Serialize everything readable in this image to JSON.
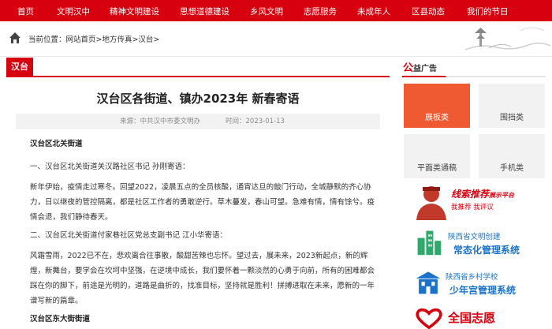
{
  "nav": {
    "items": [
      "首页",
      "文明汉中",
      "精神文明建设",
      "思想道德建设",
      "乡风文明",
      "志愿服务",
      "未成年人",
      "区县动态",
      "我们的节日"
    ]
  },
  "breadcrumb": {
    "label": "当前位置：",
    "path": "网站首页>地方传真>汉台>"
  },
  "section": {
    "tab": "汉台"
  },
  "article": {
    "title": "汉台区各街道、镇办2023年  新春寄语",
    "source": "来源：中共汉中市委文明办",
    "time": "时间：2023-01-13",
    "paragraphs": [
      {
        "bold": true,
        "text": "汉台区北关街道"
      },
      {
        "bold": false,
        "text": "一、汉台区北关街道关汉路社区书记 孙刚寄语："
      },
      {
        "bold": false,
        "text": "新年伊始，疫情走过寒冬。回望2022，凌晨五点的全员核酸，通宵达旦的敲门行动，全城静默的齐心协力，日以继夜的管控隔离，都是社区工作者的勇敢逆行。草木蔓发，春山可望。急难有情，情有馀兮。疫情会退，我们静待春天。"
      },
      {
        "bold": false,
        "text": "二、汉台区北关街道付家巷社区党总支副书记 江小华寄语："
      },
      {
        "bold": false,
        "text": "风霜雪雨，2022已不在，悲欢离合往事散，酸甜苦辣也忘怀。望过去，展未来，2023新起点，新的辉煌，新舞台，要学会在坎坷中坚强，在逆境中成长，我们要怀着一颗淡然的心勇于向前，所有的困难都会踩在你的脚下，前途是光明的，道路是曲折的，找准目标，坚持就是胜利！拼搏进取在未来，愿新的一年谱写新的篇章。"
      },
      {
        "bold": true,
        "text": "汉台区东大街街道"
      }
    ]
  },
  "ads": {
    "title_first": "公",
    "title_rest": "益广告",
    "boxes": [
      "展板类",
      "围挡类",
      "平面类通稿",
      "手机类"
    ],
    "banner1": {
      "line1": "线索推荐",
      "line1_small": "展示平台",
      "line2": "我推荐 我评议"
    },
    "banner2": {
      "line1": "陕西省文明创建",
      "line2": "常态化管理系统"
    },
    "banner3": {
      "line1": "陕西省乡村学校",
      "line2": "少年宫管理系统"
    },
    "banner4": {
      "line1": "全国志愿"
    }
  },
  "colors": {
    "brand_red": "#d7000f",
    "ad_orange": "#f05a32",
    "link_blue": "#1a73c9"
  }
}
